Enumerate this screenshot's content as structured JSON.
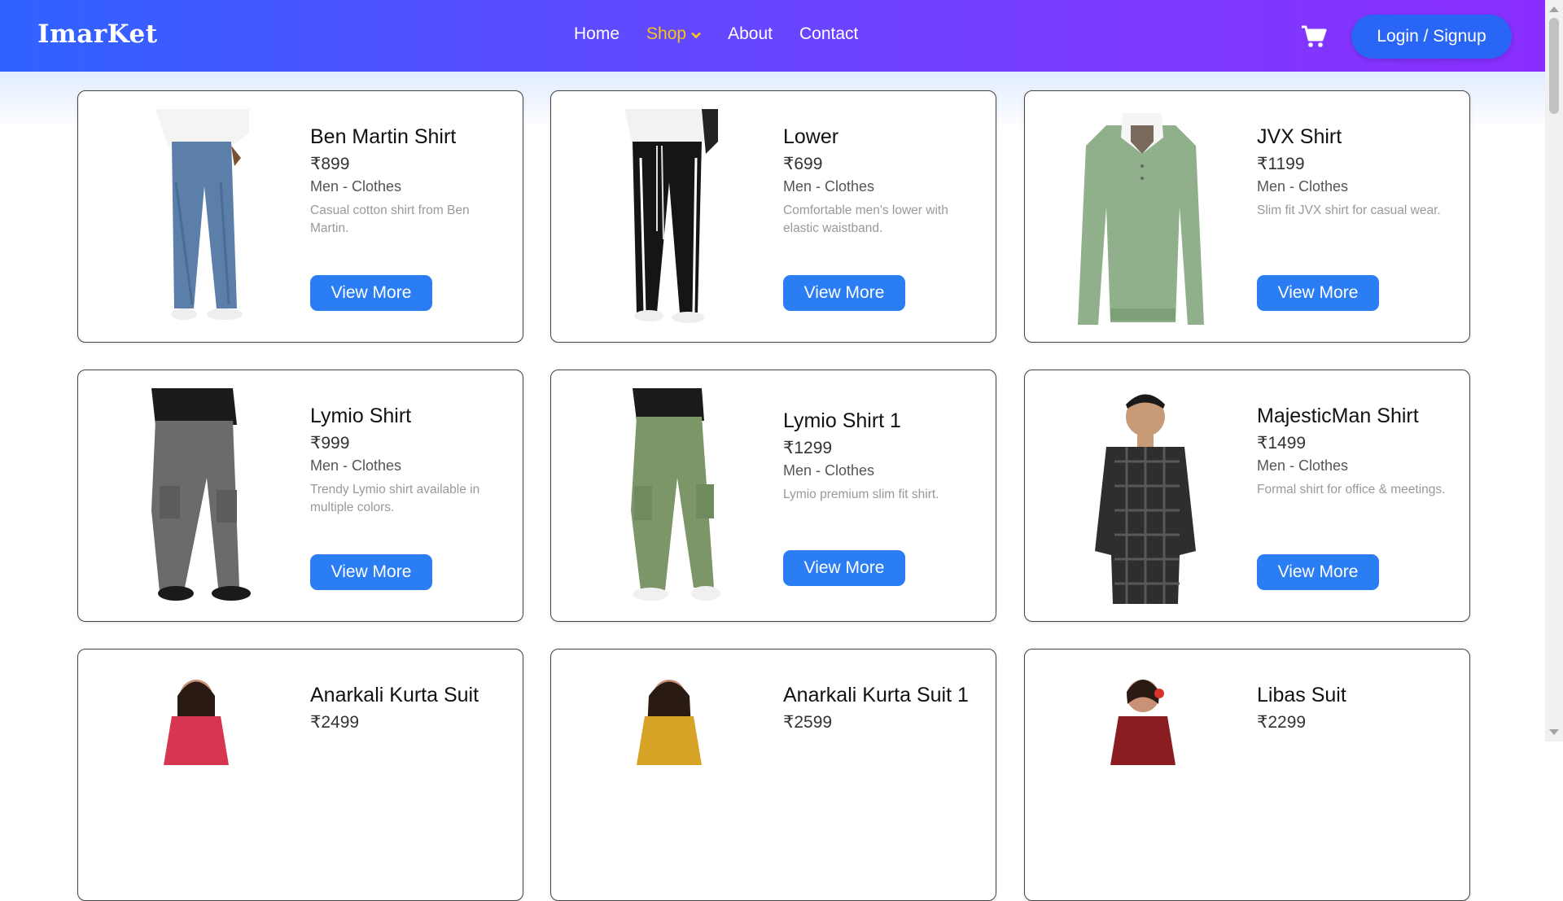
{
  "brand": "ImarKet",
  "nav": {
    "home": "Home",
    "shop": "Shop",
    "about": "About",
    "contact": "Contact",
    "login": "Login / Signup"
  },
  "colors": {
    "accent": "#2a7df2",
    "active_nav": "#f5c518",
    "navbar_start": "#2f63ff",
    "navbar_end": "#8a2eff"
  },
  "icons": {
    "cart": "cart-icon",
    "shop_caret": "chevron-down-icon"
  },
  "products": [
    {
      "name": "Ben Martin Shirt",
      "price": "₹899",
      "category": "Men - Clothes",
      "description": "Casual cotton shirt from Ben Martin.",
      "button": "View More"
    },
    {
      "name": "Lower",
      "price": "₹699",
      "category": "Men - Clothes",
      "description": "Comfortable men's lower with elastic waistband.",
      "button": "View More"
    },
    {
      "name": "JVX Shirt",
      "price": "₹1199",
      "category": "Men - Clothes",
      "description": "Slim fit JVX shirt for casual wear.",
      "button": "View More"
    },
    {
      "name": "Lymio Shirt",
      "price": "₹999",
      "category": "Men - Clothes",
      "description": "Trendy Lymio shirt available in multiple colors.",
      "button": "View More"
    },
    {
      "name": "Lymio Shirt 1",
      "price": "₹1299",
      "category": "Men - Clothes",
      "description": "Lymio premium slim fit shirt.",
      "button": "View More"
    },
    {
      "name": "MajesticMan Shirt",
      "price": "₹1499",
      "category": "Men - Clothes",
      "description": "Formal shirt for office & meetings.",
      "button": "View More"
    },
    {
      "name": "Anarkali Kurta Suit",
      "price": "₹2499"
    },
    {
      "name": "Anarkali Kurta Suit 1",
      "price": "₹2599"
    },
    {
      "name": "Libas Suit",
      "price": "₹2299"
    }
  ]
}
